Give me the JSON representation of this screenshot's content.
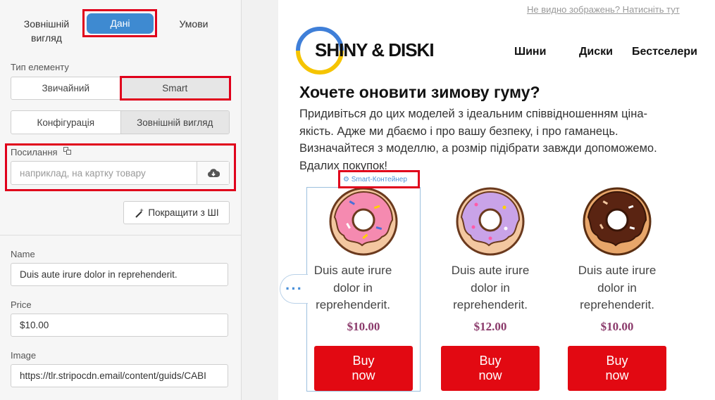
{
  "sidebar": {
    "tabs": {
      "appearance": "Зовнішній вигляд",
      "data": "Дані",
      "conditions": "Умови"
    },
    "element_type": {
      "label": "Тип елементу",
      "options": [
        "Звичайний",
        "Smart"
      ],
      "selected": "Smart"
    },
    "config_tabs": {
      "options": [
        "Конфігурація",
        "Зовнішній вигляд"
      ],
      "selected": "Зовнішній вигляд"
    },
    "link": {
      "label": "Посилання",
      "placeholder": "наприклад, на картку товару"
    },
    "ai_button": "Покращити з ШІ",
    "fields": {
      "name_label": "Name",
      "name_value": "Duis aute irure dolor in reprehenderit.",
      "price_label": "Price",
      "price_value": "$10.00",
      "image_label": "Image",
      "image_value": "https://tlr.stripocdn.email/content/guids/CABI"
    }
  },
  "preview": {
    "notice": "Не видно зображень? Натисніть тут",
    "brand": "SHINY & DISKI",
    "nav": [
      "Шини",
      "Диски",
      "Бестселери"
    ],
    "hero_title": "Хочете оновити зимову гуму?",
    "hero_text": "Придивіться до цих моделей з ідеальним співвідношенням ціна-якість. Адже ми дбаємо і про вашу безпеку, і про гаманець. Визначайтеся з моделлю, а розмір підібрати завжди допоможемо. Вдалих покупок!",
    "smart_label": "Smart-Контейнер",
    "products": [
      {
        "name": "Duis aute irure dolor in reprehenderit.",
        "price": "$10.00",
        "button": "Buy now",
        "donut": "pink-donut"
      },
      {
        "name": "Duis aute irure dolor in reprehenderit.",
        "price": "$12.00",
        "button": "Buy now",
        "donut": "purple-donut"
      },
      {
        "name": "Duis aute irure dolor in reprehenderit.",
        "price": "$10.00",
        "button": "Buy now",
        "donut": "chocolate-donut"
      }
    ]
  },
  "colors": {
    "accent": "#3e8ad1",
    "highlight": "#e0001b",
    "buy": "#e20912",
    "price": "#8b3a6b"
  }
}
